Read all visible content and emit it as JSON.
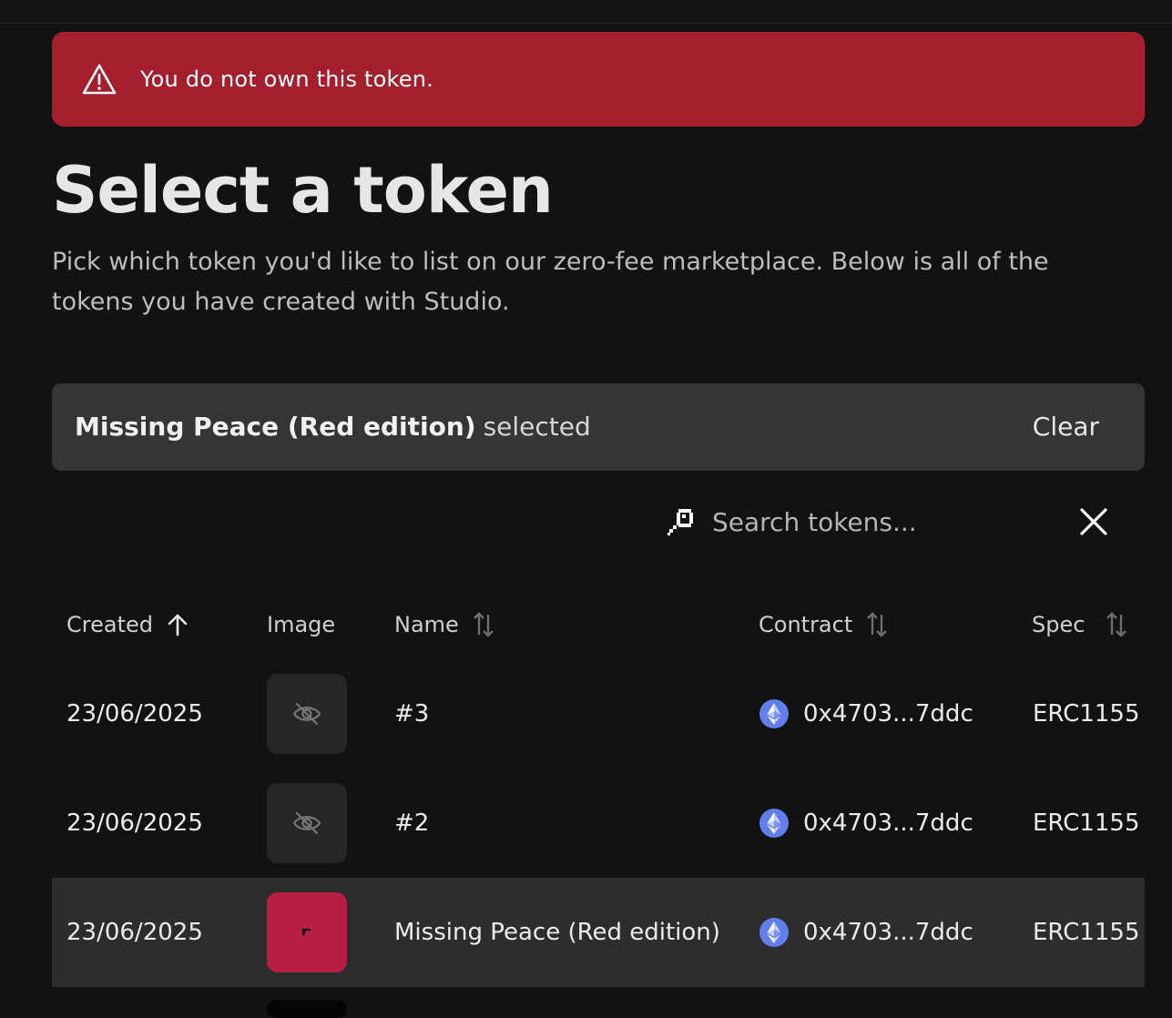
{
  "alert": {
    "message": "You do not own this token.",
    "icon": "warning-triangle-icon",
    "color": "#a51e2e"
  },
  "page": {
    "title": "Select a token",
    "description": "Pick which token you'd like to list on our zero-fee marketplace. Below is all of the tokens you have created with Studio."
  },
  "selection": {
    "name": "Missing Peace (Red edition)",
    "suffix": "selected",
    "clear_label": "Clear"
  },
  "search": {
    "placeholder": "Search tokens...",
    "value": ""
  },
  "table": {
    "columns": [
      {
        "label": "Created",
        "sort": "ascending"
      },
      {
        "label": "Image",
        "sort": "none"
      },
      {
        "label": "Name",
        "sort": "unsorted"
      },
      {
        "label": "Contract",
        "sort": "unsorted"
      },
      {
        "label": "Spec",
        "sort": "unsorted"
      }
    ],
    "rows": [
      {
        "created": "23/06/2025",
        "image": "hidden-icon",
        "name": "#3",
        "contract": "0x4703...7ddc",
        "spec": "ERC1155",
        "selected": false
      },
      {
        "created": "23/06/2025",
        "image": "hidden-icon",
        "name": "#2",
        "contract": "0x4703...7ddc",
        "spec": "ERC1155",
        "selected": false
      },
      {
        "created": "23/06/2025",
        "image": "red-thumbnail",
        "name": "Missing Peace (Red edition)",
        "contract": "0x4703...7ddc",
        "spec": "ERC1155",
        "selected": true
      }
    ]
  },
  "colors": {
    "background": "#121212",
    "selection_bar": "#353535",
    "selected_row": "#2d2d2d",
    "thumbnail_red": "#b81d43",
    "ethereum_blue": "#627eea"
  }
}
